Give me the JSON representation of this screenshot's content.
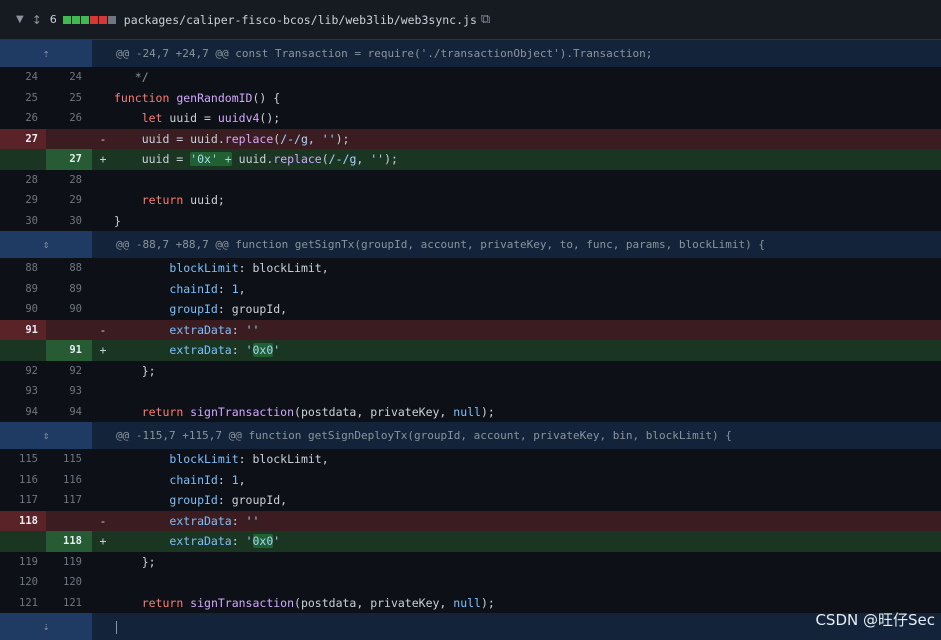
{
  "header": {
    "count": "6",
    "path": "packages/caliper-fisco-bcos/lib/web3lib/web3sync.js",
    "diffstat": [
      "add",
      "add",
      "add",
      "del",
      "del",
      "neutral"
    ]
  },
  "hunks": [
    {
      "header": "@@ -24,7 +24,7 @@ const Transaction = require('./transactionObject').Transaction;",
      "rows": [
        {
          "type": "ctx",
          "l": "24",
          "r": "24",
          "tokens": [
            [
              "   */",
              "cm"
            ]
          ]
        },
        {
          "type": "ctx",
          "l": "25",
          "r": "25",
          "tokens": [
            [
              "function ",
              "kw"
            ],
            [
              "genRandomID",
              "fn"
            ],
            [
              "() {",
              ""
            ]
          ]
        },
        {
          "type": "ctx",
          "l": "26",
          "r": "26",
          "tokens": [
            [
              "    ",
              ""
            ],
            [
              "let ",
              "kw"
            ],
            [
              "uuid = ",
              ""
            ],
            [
              "uuidv4",
              "fn"
            ],
            [
              "();",
              ""
            ]
          ]
        },
        {
          "type": "del",
          "l": "27",
          "r": "",
          "tokens": [
            [
              "    uuid = uuid.",
              ""
            ],
            [
              "replace",
              "fn"
            ],
            [
              "(",
              ""
            ],
            [
              "/-/g",
              "str"
            ],
            [
              ", ",
              ""
            ],
            [
              "''",
              "str"
            ],
            [
              ");",
              ""
            ]
          ]
        },
        {
          "type": "add",
          "l": "",
          "r": "27",
          "tokens": [
            [
              "    uuid = ",
              ""
            ],
            [
              "'0x' +",
              "hlstr"
            ],
            [
              " uuid.",
              ""
            ],
            [
              "replace",
              "fn"
            ],
            [
              "(",
              ""
            ],
            [
              "/-/g",
              "str"
            ],
            [
              ", ",
              ""
            ],
            [
              "''",
              "str"
            ],
            [
              ");",
              ""
            ]
          ]
        },
        {
          "type": "ctx",
          "l": "28",
          "r": "28",
          "tokens": [
            [
              "",
              ""
            ]
          ]
        },
        {
          "type": "ctx",
          "l": "29",
          "r": "29",
          "tokens": [
            [
              "    ",
              ""
            ],
            [
              "return ",
              "kw"
            ],
            [
              "uuid;",
              ""
            ]
          ]
        },
        {
          "type": "ctx",
          "l": "30",
          "r": "30",
          "tokens": [
            [
              "}",
              ""
            ]
          ]
        }
      ]
    },
    {
      "header": "@@ -88,7 +88,7 @@ function getSignTx(groupId, account, privateKey, to, func, params, blockLimit) {",
      "rows": [
        {
          "type": "ctx",
          "l": "88",
          "r": "88",
          "tokens": [
            [
              "        ",
              ""
            ],
            [
              "blockLimit",
              "prop"
            ],
            [
              ": blockLimit,",
              ""
            ]
          ]
        },
        {
          "type": "ctx",
          "l": "89",
          "r": "89",
          "tokens": [
            [
              "        ",
              ""
            ],
            [
              "chainId",
              "prop"
            ],
            [
              ": ",
              ""
            ],
            [
              "1",
              "num-lit"
            ],
            [
              ",",
              ""
            ]
          ]
        },
        {
          "type": "ctx",
          "l": "90",
          "r": "90",
          "tokens": [
            [
              "        ",
              ""
            ],
            [
              "groupId",
              "prop"
            ],
            [
              ": groupId,",
              ""
            ]
          ]
        },
        {
          "type": "del",
          "l": "91",
          "r": "",
          "tokens": [
            [
              "        ",
              ""
            ],
            [
              "extraData",
              "prop"
            ],
            [
              ": ",
              ""
            ],
            [
              "''",
              "str"
            ]
          ]
        },
        {
          "type": "add",
          "l": "",
          "r": "91",
          "tokens": [
            [
              "        ",
              ""
            ],
            [
              "extraData",
              "prop"
            ],
            [
              ": ",
              ""
            ],
            [
              "'",
              "str"
            ],
            [
              "0x0",
              "hlstr"
            ],
            [
              "'",
              "str"
            ]
          ]
        },
        {
          "type": "ctx",
          "l": "92",
          "r": "92",
          "tokens": [
            [
              "    };",
              ""
            ]
          ]
        },
        {
          "type": "ctx",
          "l": "93",
          "r": "93",
          "tokens": [
            [
              "",
              ""
            ]
          ]
        },
        {
          "type": "ctx",
          "l": "94",
          "r": "94",
          "tokens": [
            [
              "    ",
              ""
            ],
            [
              "return ",
              "kw"
            ],
            [
              "signTransaction",
              "fn"
            ],
            [
              "(postdata, privateKey, ",
              ""
            ],
            [
              "null",
              "num-lit"
            ],
            [
              ");",
              ""
            ]
          ]
        }
      ]
    },
    {
      "header": "@@ -115,7 +115,7 @@ function getSignDeployTx(groupId, account, privateKey, bin, blockLimit) {",
      "rows": [
        {
          "type": "ctx",
          "l": "115",
          "r": "115",
          "tokens": [
            [
              "        ",
              ""
            ],
            [
              "blockLimit",
              "prop"
            ],
            [
              ": blockLimit,",
              ""
            ]
          ]
        },
        {
          "type": "ctx",
          "l": "116",
          "r": "116",
          "tokens": [
            [
              "        ",
              ""
            ],
            [
              "chainId",
              "prop"
            ],
            [
              ": ",
              ""
            ],
            [
              "1",
              "num-lit"
            ],
            [
              ",",
              ""
            ]
          ]
        },
        {
          "type": "ctx",
          "l": "117",
          "r": "117",
          "tokens": [
            [
              "        ",
              ""
            ],
            [
              "groupId",
              "prop"
            ],
            [
              ": groupId,",
              ""
            ]
          ]
        },
        {
          "type": "del",
          "l": "118",
          "r": "",
          "tokens": [
            [
              "        ",
              ""
            ],
            [
              "extraData",
              "prop"
            ],
            [
              ": ",
              ""
            ],
            [
              "''",
              "str"
            ]
          ]
        },
        {
          "type": "add",
          "l": "",
          "r": "118",
          "tokens": [
            [
              "        ",
              ""
            ],
            [
              "extraData",
              "prop"
            ],
            [
              ": ",
              ""
            ],
            [
              "'",
              "str"
            ],
            [
              "0x0",
              "hlstr"
            ],
            [
              "'",
              "str"
            ]
          ]
        },
        {
          "type": "ctx",
          "l": "119",
          "r": "119",
          "tokens": [
            [
              "    };",
              ""
            ]
          ]
        },
        {
          "type": "ctx",
          "l": "120",
          "r": "120",
          "tokens": [
            [
              "",
              ""
            ]
          ]
        },
        {
          "type": "ctx",
          "l": "121",
          "r": "121",
          "tokens": [
            [
              "    ",
              ""
            ],
            [
              "return ",
              "kw"
            ],
            [
              "signTransaction",
              "fn"
            ],
            [
              "(postdata, privateKey, ",
              ""
            ],
            [
              "null",
              "num-lit"
            ],
            [
              ");",
              ""
            ]
          ]
        }
      ]
    }
  ],
  "watermark": "CSDN @旺仔Sec"
}
